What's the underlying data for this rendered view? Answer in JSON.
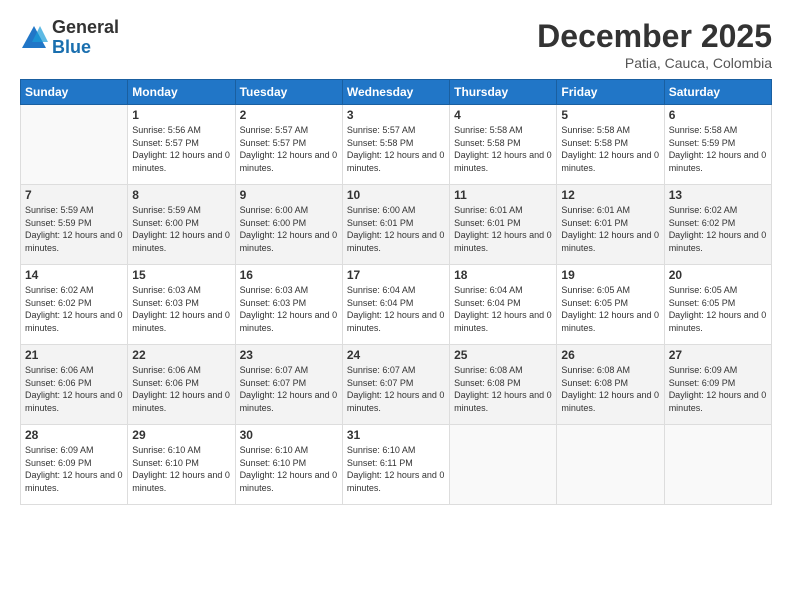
{
  "logo": {
    "general": "General",
    "blue": "Blue"
  },
  "header": {
    "month": "December 2025",
    "location": "Patia, Cauca, Colombia"
  },
  "weekdays": [
    "Sunday",
    "Monday",
    "Tuesday",
    "Wednesday",
    "Thursday",
    "Friday",
    "Saturday"
  ],
  "weeks": [
    [
      {
        "day": "",
        "sunrise": "",
        "sunset": "",
        "daylight": ""
      },
      {
        "day": "1",
        "sunrise": "Sunrise: 5:56 AM",
        "sunset": "Sunset: 5:57 PM",
        "daylight": "Daylight: 12 hours and 0 minutes."
      },
      {
        "day": "2",
        "sunrise": "Sunrise: 5:57 AM",
        "sunset": "Sunset: 5:57 PM",
        "daylight": "Daylight: 12 hours and 0 minutes."
      },
      {
        "day": "3",
        "sunrise": "Sunrise: 5:57 AM",
        "sunset": "Sunset: 5:58 PM",
        "daylight": "Daylight: 12 hours and 0 minutes."
      },
      {
        "day": "4",
        "sunrise": "Sunrise: 5:58 AM",
        "sunset": "Sunset: 5:58 PM",
        "daylight": "Daylight: 12 hours and 0 minutes."
      },
      {
        "day": "5",
        "sunrise": "Sunrise: 5:58 AM",
        "sunset": "Sunset: 5:58 PM",
        "daylight": "Daylight: 12 hours and 0 minutes."
      },
      {
        "day": "6",
        "sunrise": "Sunrise: 5:58 AM",
        "sunset": "Sunset: 5:59 PM",
        "daylight": "Daylight: 12 hours and 0 minutes."
      }
    ],
    [
      {
        "day": "7",
        "sunrise": "Sunrise: 5:59 AM",
        "sunset": "Sunset: 5:59 PM",
        "daylight": "Daylight: 12 hours and 0 minutes."
      },
      {
        "day": "8",
        "sunrise": "Sunrise: 5:59 AM",
        "sunset": "Sunset: 6:00 PM",
        "daylight": "Daylight: 12 hours and 0 minutes."
      },
      {
        "day": "9",
        "sunrise": "Sunrise: 6:00 AM",
        "sunset": "Sunset: 6:00 PM",
        "daylight": "Daylight: 12 hours and 0 minutes."
      },
      {
        "day": "10",
        "sunrise": "Sunrise: 6:00 AM",
        "sunset": "Sunset: 6:01 PM",
        "daylight": "Daylight: 12 hours and 0 minutes."
      },
      {
        "day": "11",
        "sunrise": "Sunrise: 6:01 AM",
        "sunset": "Sunset: 6:01 PM",
        "daylight": "Daylight: 12 hours and 0 minutes."
      },
      {
        "day": "12",
        "sunrise": "Sunrise: 6:01 AM",
        "sunset": "Sunset: 6:01 PM",
        "daylight": "Daylight: 12 hours and 0 minutes."
      },
      {
        "day": "13",
        "sunrise": "Sunrise: 6:02 AM",
        "sunset": "Sunset: 6:02 PM",
        "daylight": "Daylight: 12 hours and 0 minutes."
      }
    ],
    [
      {
        "day": "14",
        "sunrise": "Sunrise: 6:02 AM",
        "sunset": "Sunset: 6:02 PM",
        "daylight": "Daylight: 12 hours and 0 minutes."
      },
      {
        "day": "15",
        "sunrise": "Sunrise: 6:03 AM",
        "sunset": "Sunset: 6:03 PM",
        "daylight": "Daylight: 12 hours and 0 minutes."
      },
      {
        "day": "16",
        "sunrise": "Sunrise: 6:03 AM",
        "sunset": "Sunset: 6:03 PM",
        "daylight": "Daylight: 12 hours and 0 minutes."
      },
      {
        "day": "17",
        "sunrise": "Sunrise: 6:04 AM",
        "sunset": "Sunset: 6:04 PM",
        "daylight": "Daylight: 12 hours and 0 minutes."
      },
      {
        "day": "18",
        "sunrise": "Sunrise: 6:04 AM",
        "sunset": "Sunset: 6:04 PM",
        "daylight": "Daylight: 12 hours and 0 minutes."
      },
      {
        "day": "19",
        "sunrise": "Sunrise: 6:05 AM",
        "sunset": "Sunset: 6:05 PM",
        "daylight": "Daylight: 12 hours and 0 minutes."
      },
      {
        "day": "20",
        "sunrise": "Sunrise: 6:05 AM",
        "sunset": "Sunset: 6:05 PM",
        "daylight": "Daylight: 12 hours and 0 minutes."
      }
    ],
    [
      {
        "day": "21",
        "sunrise": "Sunrise: 6:06 AM",
        "sunset": "Sunset: 6:06 PM",
        "daylight": "Daylight: 12 hours and 0 minutes."
      },
      {
        "day": "22",
        "sunrise": "Sunrise: 6:06 AM",
        "sunset": "Sunset: 6:06 PM",
        "daylight": "Daylight: 12 hours and 0 minutes."
      },
      {
        "day": "23",
        "sunrise": "Sunrise: 6:07 AM",
        "sunset": "Sunset: 6:07 PM",
        "daylight": "Daylight: 12 hours and 0 minutes."
      },
      {
        "day": "24",
        "sunrise": "Sunrise: 6:07 AM",
        "sunset": "Sunset: 6:07 PM",
        "daylight": "Daylight: 12 hours and 0 minutes."
      },
      {
        "day": "25",
        "sunrise": "Sunrise: 6:08 AM",
        "sunset": "Sunset: 6:08 PM",
        "daylight": "Daylight: 12 hours and 0 minutes."
      },
      {
        "day": "26",
        "sunrise": "Sunrise: 6:08 AM",
        "sunset": "Sunset: 6:08 PM",
        "daylight": "Daylight: 12 hours and 0 minutes."
      },
      {
        "day": "27",
        "sunrise": "Sunrise: 6:09 AM",
        "sunset": "Sunset: 6:09 PM",
        "daylight": "Daylight: 12 hours and 0 minutes."
      }
    ],
    [
      {
        "day": "28",
        "sunrise": "Sunrise: 6:09 AM",
        "sunset": "Sunset: 6:09 PM",
        "daylight": "Daylight: 12 hours and 0 minutes."
      },
      {
        "day": "29",
        "sunrise": "Sunrise: 6:10 AM",
        "sunset": "Sunset: 6:10 PM",
        "daylight": "Daylight: 12 hours and 0 minutes."
      },
      {
        "day": "30",
        "sunrise": "Sunrise: 6:10 AM",
        "sunset": "Sunset: 6:10 PM",
        "daylight": "Daylight: 12 hours and 0 minutes."
      },
      {
        "day": "31",
        "sunrise": "Sunrise: 6:10 AM",
        "sunset": "Sunset: 6:11 PM",
        "daylight": "Daylight: 12 hours and 0 minutes."
      },
      {
        "day": "",
        "sunrise": "",
        "sunset": "",
        "daylight": ""
      },
      {
        "day": "",
        "sunrise": "",
        "sunset": "",
        "daylight": ""
      },
      {
        "day": "",
        "sunrise": "",
        "sunset": "",
        "daylight": ""
      }
    ]
  ]
}
